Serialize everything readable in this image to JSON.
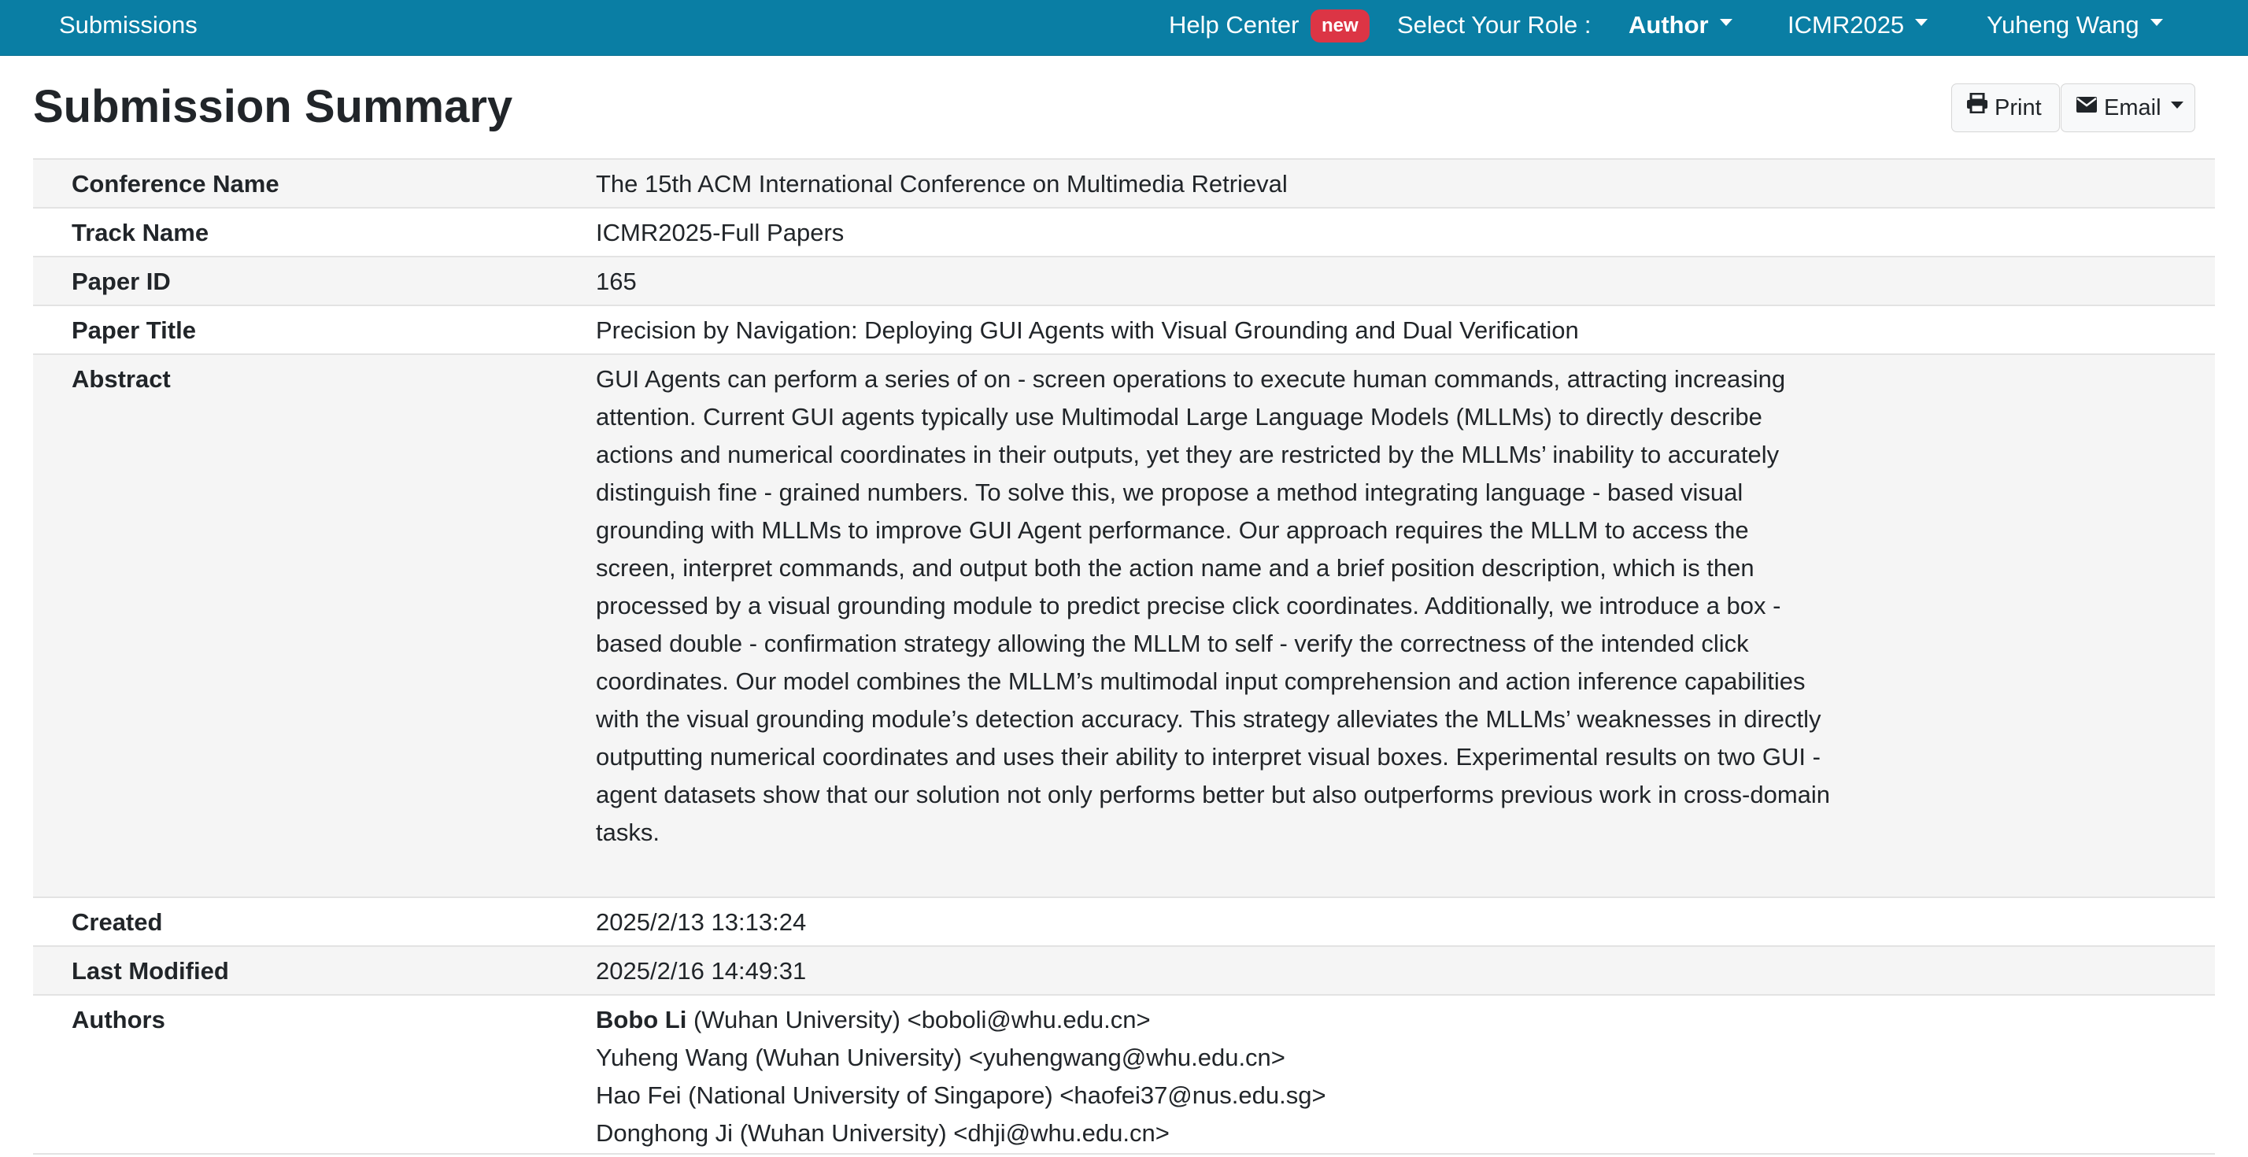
{
  "navbar": {
    "submissions": "Submissions",
    "help_center": "Help Center",
    "help_badge": "new",
    "role_label": "Select Your Role :",
    "role_value": "Author",
    "conference": "ICMR2025",
    "user": "Yuheng Wang",
    "bg_color": "#0a7ea4"
  },
  "page": {
    "title": "Submission Summary",
    "print_label": "Print",
    "email_label": "Email"
  },
  "summary": {
    "conference_name": {
      "label": "Conference Name",
      "value": "The 15th ACM International Conference on Multimedia Retrieval"
    },
    "track_name": {
      "label": "Track Name",
      "value": "ICMR2025-Full Papers"
    },
    "paper_id": {
      "label": "Paper ID",
      "value": "165"
    },
    "paper_title": {
      "label": "Paper Title",
      "value": "Precision by Navigation: Deploying GUI Agents with Visual Grounding and Dual Verification"
    },
    "abstract": {
      "label": "Abstract",
      "value": "GUI Agents can perform a series of on - screen operations to execute human commands, attracting increasing attention. Current GUI agents typically use Multimodal Large Language Models (MLLMs) to directly describe actions and numerical coordinates in their outputs, yet they are restricted by the MLLMs’ inability to accurately distinguish fine - grained numbers. To solve this, we propose a method integrating language - based visual grounding with MLLMs to improve GUI Agent performance. Our approach requires the MLLM to access the screen, interpret commands, and output both the action name and a brief position description, which is then processed by a visual grounding module to predict precise click coordinates. Additionally, we introduce a box - based double - confirmation strategy allowing the MLLM to self - verify the correctness of the intended click coordinates. Our model combines the MLLM’s multimodal input comprehension and action inference capabilities with the visual grounding module’s detection accuracy. This strategy alleviates the MLLMs’ weaknesses in directly outputting numerical coordinates and uses their ability to interpret visual boxes. Experimental results on two GUI - agent datasets show that our solution not only performs better but also outperforms previous work in cross-domain tasks."
    },
    "created": {
      "label": "Created",
      "value": "2025/2/13 13:13:24"
    },
    "last_modified": {
      "label": "Last Modified",
      "value": "2025/2/16 14:49:31"
    },
    "authors": {
      "label": "Authors",
      "items": [
        {
          "name": "Bobo Li",
          "details": " (Wuhan University) <boboli@whu.edu.cn>"
        },
        {
          "name": "Yuheng Wang",
          "details": " (Wuhan University) <yuhengwang@whu.edu.cn>"
        },
        {
          "name": "Hao Fei",
          "details": " (National University of Singapore) <haofei37@nus.edu.sg>"
        },
        {
          "name": "Donghong Ji",
          "details": " (Wuhan University) <dhji@whu.edu.cn>"
        }
      ]
    }
  }
}
